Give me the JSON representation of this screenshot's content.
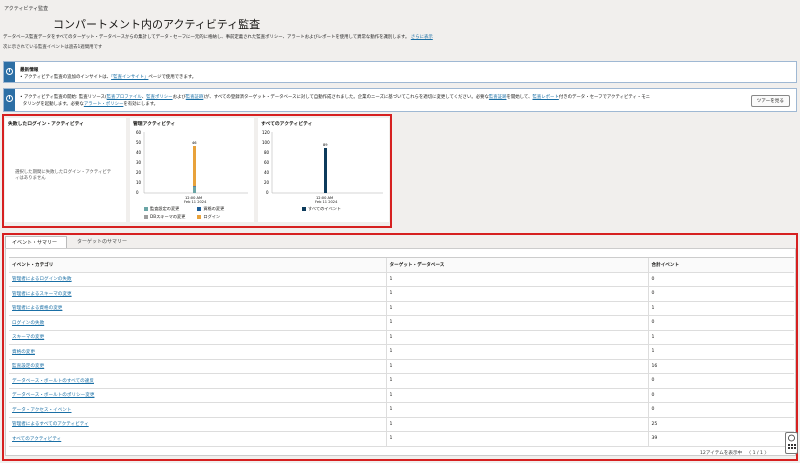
{
  "breadcrumb": "アクティビティ監査",
  "page_title": "コンパートメント内のアクティビティ監査",
  "description": "データベース監査データをすべてのターゲット・データベースからの集計してデータ・セーフに一元的に格納し、事前定義された監査ポリシー、アラートおよびレポートを使用して異常な動作を識別します。",
  "description_link": "さらに表示",
  "period_note": "次に示されている監査イベントは過去1週間用です",
  "banner1": {
    "title": "最新情報",
    "text": "アクティビティ監査の追加のインサイトは、",
    "link": "「監査インサイト」",
    "text_after": "ページで使用できます。"
  },
  "banner2": {
    "line1_a": "アクティビティ監査の開始: 監査リソース(",
    "link1": "監査プロファイル",
    "sep1": "、",
    "link2": "監査ポリシー",
    "mid1": "および",
    "link3": "監査証跡",
    "line1_b": ")が、すべての登録済ターゲット・データベースに対して自動作成されました。企業のニーズに基づいてこれらを適切に変更してください。必要な",
    "link4": "監査証跡",
    "line1_c": "を開始して、",
    "link5": "監査レポート",
    "line1_d": "付きのデータ・セーフでアクティビティ・モニ",
    "line2_a": "タリングを起動します。必要な",
    "link6": "アラート・ポリシー",
    "line2_b": "を有効にします。",
    "tour_button": "ツアーを見る"
  },
  "panels": {
    "failed_logins": {
      "title": "失敗したログイン・アクティビティ",
      "empty_text": "選択した期間に失敗したログイン・アクティビティはありません"
    },
    "admin_activity": {
      "title": "管理アクティビティ",
      "y_ticks": [
        "60",
        "50",
        "40",
        "30",
        "20",
        "10",
        "0"
      ],
      "x_label_1": "12:00 AM",
      "x_label_2": "Feb 11 2024",
      "total_label": "46",
      "legend": [
        "監査設定の変更",
        "資格の変更",
        "DBスキーマの変更",
        "ログイン"
      ]
    },
    "all_activity": {
      "title": "すべてのアクティビティ",
      "y_ticks": [
        "120",
        "100",
        "80",
        "60",
        "40",
        "20",
        "0"
      ],
      "x_label_1": "12:00 AM",
      "x_label_2": "Feb 11 2024",
      "total_label": "89",
      "legend": [
        "すべてのイベント"
      ]
    }
  },
  "colors": {
    "audit_setting": "#6aa5a6",
    "entitlement": "#1f5f99",
    "schema": "#9e9e9e",
    "login": "#e8a23b",
    "all_events": "#0d3b5c"
  },
  "tabs": [
    "イベント・サマリー",
    "ターゲットのサマリー"
  ],
  "table": {
    "headers": [
      "イベント・カテゴリ",
      "ターゲット・データベース",
      "合計イベント"
    ],
    "rows": [
      [
        "管理者によるログインの失敗",
        "1",
        "0"
      ],
      [
        "管理者によるスキーマの変更",
        "1",
        "0"
      ],
      [
        "管理者による資格の変更",
        "1",
        "1"
      ],
      [
        "ログインの失敗",
        "1",
        "0"
      ],
      [
        "スキーマの変更",
        "1",
        "1"
      ],
      [
        "資格の変更",
        "1",
        "1"
      ],
      [
        "監査設定の変更",
        "1",
        "16"
      ],
      [
        "データベース・ボールトのすべての違反",
        "1",
        "0"
      ],
      [
        "データベース・ボールトのポリシー変更",
        "1",
        "0"
      ],
      [
        "データ・アクセス・イベント",
        "1",
        "0"
      ],
      [
        "管理者によるすべてのアクティビティ",
        "1",
        "25"
      ],
      [
        "すべてのアクティビティ",
        "1",
        "39"
      ]
    ]
  },
  "footer": {
    "count_text": "12アイテムを表示中",
    "pager": "〈 1 / 1 〉"
  }
}
